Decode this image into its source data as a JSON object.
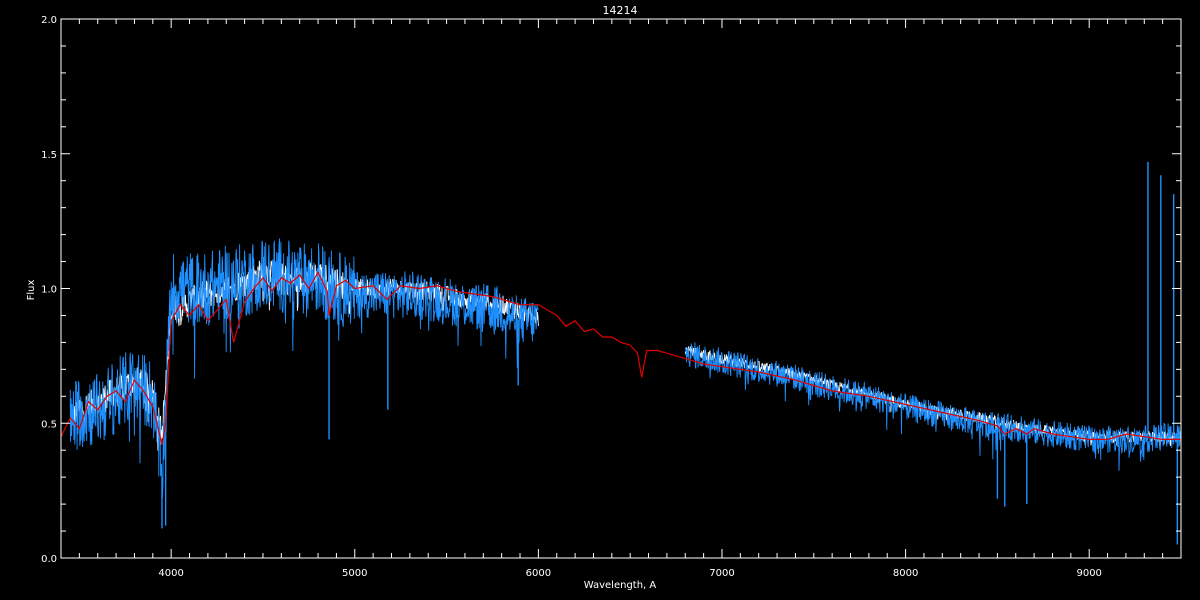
{
  "chart_data": {
    "type": "line",
    "title": "14214",
    "xlabel": "Wavelength, A",
    "ylabel": "Flux",
    "xlim": [
      3400,
      9500
    ],
    "ylim": [
      0.0,
      2.0
    ],
    "x_ticks": [
      4000,
      5000,
      6000,
      7000,
      8000,
      9000
    ],
    "x_tick_labels": [
      "4000",
      "5000",
      "6000",
      "7000",
      "8000",
      "9000"
    ],
    "y_ticks": [
      0.0,
      0.5,
      1.0,
      1.5,
      2.0
    ],
    "y_tick_labels": [
      "0.0",
      "0.5",
      "1.0",
      "1.5",
      "2.0"
    ],
    "grid": false,
    "background": "#000000",
    "axis_color": "#ffffff",
    "series": [
      {
        "color": "#ffffff",
        "noise": 0.04,
        "segments": [
          {
            "x": [
              3450,
              3500,
              3600,
              3700,
              3800,
              3900,
              3950,
              4000,
              4100,
              4200,
              4300,
              4400,
              4500,
              4600,
              4700,
              4800,
              4900,
              5000,
              5200,
              5400,
              5600,
              5800,
              6000
            ],
            "y": [
              0.5,
              0.55,
              0.58,
              0.62,
              0.66,
              0.62,
              0.45,
              0.92,
              0.95,
              0.98,
              1.0,
              1.02,
              1.06,
              1.04,
              1.03,
              1.05,
              1.02,
              1.0,
              1.0,
              0.99,
              0.96,
              0.94,
              0.89
            ]
          },
          {
            "x": [
              6800,
              7000,
              7200,
              7400,
              7600,
              7800,
              8000,
              8200,
              8400,
              8600,
              8800,
              9000,
              9200,
              9400,
              9500
            ],
            "y": [
              0.77,
              0.74,
              0.71,
              0.68,
              0.64,
              0.61,
              0.57,
              0.54,
              0.52,
              0.49,
              0.47,
              0.45,
              0.45,
              0.45,
              0.45
            ]
          }
        ]
      },
      {
        "color": "#1e90ff",
        "noise": 0.1,
        "segments": [
          {
            "x": [
              3450,
              3500,
              3600,
              3700,
              3800,
              3900,
              3950,
              4000,
              4100,
              4200,
              4300,
              4400,
              4500,
              4600,
              4700,
              4800,
              4900,
              5000,
              5200,
              5400,
              5600,
              5800,
              5900,
              6000
            ],
            "y": [
              0.5,
              0.55,
              0.55,
              0.6,
              0.65,
              0.6,
              0.3,
              1.0,
              1.0,
              1.0,
              1.02,
              1.03,
              1.06,
              1.05,
              1.03,
              1.04,
              1.0,
              0.98,
              0.98,
              0.97,
              0.94,
              0.92,
              0.88,
              0.88
            ]
          },
          {
            "x": [
              6800,
              7000,
              7200,
              7400,
              7600,
              7800,
              8000,
              8200,
              8400,
              8600,
              8800,
              9000,
              9200,
              9300,
              9400,
              9500
            ],
            "y": [
              0.76,
              0.73,
              0.7,
              0.67,
              0.63,
              0.6,
              0.56,
              0.53,
              0.5,
              0.48,
              0.46,
              0.44,
              0.44,
              0.44,
              0.45,
              0.45
            ]
          }
        ],
        "spikes": [
          {
            "x": 3950,
            "y": 0.11
          },
          {
            "x": 3970,
            "y": 0.12
          },
          {
            "x": 4860,
            "y": 0.44
          },
          {
            "x": 5180,
            "y": 0.55
          },
          {
            "x": 5890,
            "y": 0.64
          },
          {
            "x": 8500,
            "y": 0.22
          },
          {
            "x": 8540,
            "y": 0.19
          },
          {
            "x": 8660,
            "y": 0.2
          },
          {
            "x": 9320,
            "y": 1.47
          },
          {
            "x": 9390,
            "y": 1.42
          },
          {
            "x": 9460,
            "y": 1.35
          },
          {
            "x": 9480,
            "y": 0.05
          }
        ]
      },
      {
        "color": "#e00000",
        "noise": 0.0,
        "segments": [
          {
            "x": [
              3400,
              3450,
              3500,
              3550,
              3600,
              3650,
              3700,
              3750,
              3800,
              3850,
              3900,
              3930,
              3950,
              3970,
              4000,
              4050,
              4100,
              4150,
              4200,
              4250,
              4300,
              4340,
              4400,
              4450,
              4500,
              4550,
              4600,
              4650,
              4700,
              4750,
              4800,
              4850,
              4860,
              4900,
              4950,
              5000,
              5100,
              5175,
              5250,
              5350,
              5450,
              5550,
              5650,
              5750,
              5850,
              5900,
              5950,
              6000,
              6050,
              6100,
              6150,
              6200,
              6250,
              6300,
              6350,
              6400,
              6450,
              6500,
              6540,
              6563,
              6590,
              6650,
              6700,
              6750,
              6800,
              6900,
              7000,
              7200,
              7400,
              7500,
              7600,
              7700,
              7800,
              8000,
              8200,
              8400,
              8500,
              8540,
              8600,
              8660,
              8700,
              8800,
              8900,
              9000,
              9100,
              9200,
              9300,
              9400,
              9500
            ],
            "y": [
              0.45,
              0.52,
              0.48,
              0.58,
              0.55,
              0.6,
              0.62,
              0.58,
              0.66,
              0.62,
              0.56,
              0.48,
              0.42,
              0.5,
              0.88,
              0.94,
              0.9,
              0.94,
              0.88,
              0.92,
              0.96,
              0.8,
              0.95,
              1.0,
              1.04,
              0.99,
              1.04,
              1.02,
              1.05,
              1.0,
              1.06,
              0.99,
              0.9,
              1.01,
              1.03,
              1.0,
              1.01,
              0.96,
              1.01,
              1.0,
              1.01,
              0.99,
              0.98,
              0.97,
              0.95,
              0.94,
              0.94,
              0.94,
              0.92,
              0.9,
              0.86,
              0.88,
              0.84,
              0.85,
              0.82,
              0.82,
              0.8,
              0.79,
              0.76,
              0.67,
              0.77,
              0.77,
              0.76,
              0.75,
              0.74,
              0.72,
              0.71,
              0.69,
              0.66,
              0.64,
              0.62,
              0.61,
              0.6,
              0.57,
              0.54,
              0.51,
              0.49,
              0.46,
              0.48,
              0.46,
              0.48,
              0.46,
              0.45,
              0.44,
              0.44,
              0.46,
              0.45,
              0.44,
              0.44
            ]
          }
        ]
      }
    ]
  }
}
